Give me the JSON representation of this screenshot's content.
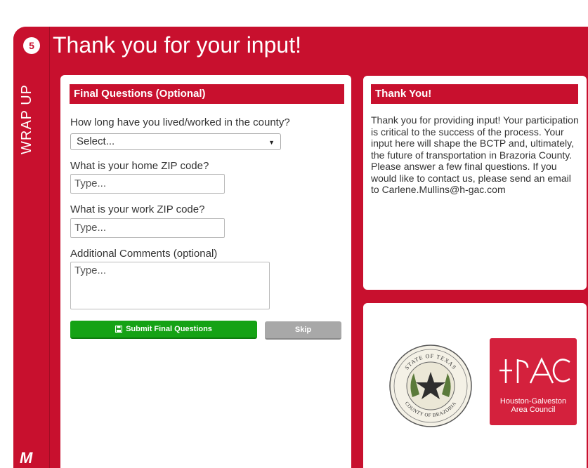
{
  "header": {
    "step_number": "5",
    "rail_label": "WRAP UP",
    "rail_logo": "M",
    "title": "Thank you for your input!"
  },
  "final_questions": {
    "header": "Final Questions (Optional)",
    "q1_label": "How long have you lived/worked in the county?",
    "q1_select_value": "Select...",
    "q2_label": "What is your home ZIP code?",
    "q2_placeholder": "Type...",
    "q3_label": "What is your work ZIP code?",
    "q3_placeholder": "Type...",
    "q4_label": "Additional Comments (optional)",
    "q4_placeholder": "Type...",
    "submit_label": "Submit Final Questions",
    "skip_label": "Skip"
  },
  "thank_you": {
    "header": "Thank You!",
    "body": "Thank you for providing input! Your participation is critical to the success of the process. Your input here will shape the BCTP and, ultimately, the future of transportation in Brazoria County. Please answer a few final questions. If you would like to contact us, please send an email to Carlene.Mullins@h-gac.com"
  },
  "logos": {
    "seal_top": "STATE OF TEXAS",
    "seal_bottom": "COUNTY OF BRAZORIA",
    "hgac_line1": "Houston-Galveston",
    "hgac_line2": "Area Council"
  },
  "colors": {
    "brand_red": "#c8102e",
    "submit_green": "#15a215",
    "skip_gray": "#a8a8a8"
  }
}
